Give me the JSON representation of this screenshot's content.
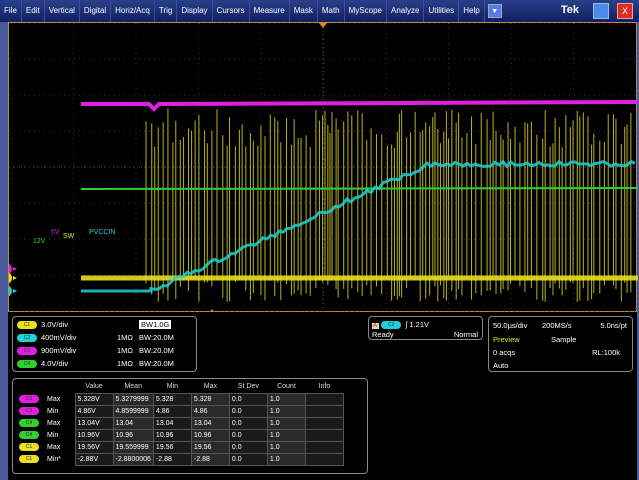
{
  "menu": [
    "File",
    "Edit",
    "Vertical",
    "Digital",
    "Horiz/Acq",
    "Trig",
    "Display",
    "Cursors",
    "Measure",
    "Mask",
    "Math",
    "MyScope",
    "Analyze",
    "Utilities",
    "Help"
  ],
  "brand": "Tek",
  "window": {
    "minimize": "_",
    "close": "X"
  },
  "trace_labels": {
    "c3": "5V",
    "c1": "SW",
    "c4": "12V",
    "c2": "PVCCIN"
  },
  "markers": [
    "3",
    "1",
    "2"
  ],
  "colors": {
    "c1": "#e8e020",
    "c2": "#20d0d8",
    "c3": "#e020e0",
    "c4": "#30d030"
  },
  "channels": [
    {
      "chip": "C1",
      "scale": "3.0V/div",
      "imp": "",
      "bw": "BW1.0G",
      "color": "#e8e020"
    },
    {
      "chip": "C2",
      "scale": "400mV/div",
      "imp": "1MΩ",
      "bw": "BW:20.0M",
      "color": "#20d0d8"
    },
    {
      "chip": "C3",
      "scale": "900mV/div",
      "imp": "1MΩ",
      "bw": "BW:20.0M",
      "color": "#e020e0"
    },
    {
      "chip": "C4",
      "scale": "4.0V/div",
      "imp": "1MΩ",
      "bw": "BW:20.0M",
      "color": "#30d030"
    }
  ],
  "trigger": {
    "a": "A'",
    "chip": "C2",
    "level": "1.21V",
    "state": "Ready",
    "mode": "Normal"
  },
  "acq": {
    "hscale": "50.0µs/div",
    "rate": "200MS/s",
    "res": "5.0ns/pt",
    "preview": "Preview",
    "sample": "Sample",
    "acqs": "0 acqs",
    "rl": "RL:100k",
    "auto": "Auto"
  },
  "meas": {
    "headers": [
      "Value",
      "Mean",
      "Min",
      "Max",
      "St Dev",
      "Count",
      "Info"
    ],
    "rows": [
      {
        "chip": "C3",
        "name": "Max",
        "cells": [
          "5.328V",
          "5.3279999",
          "5.328",
          "5.328",
          "0.0",
          "1.0",
          ""
        ],
        "color": "#e020e0"
      },
      {
        "chip": "C3",
        "name": "Min",
        "cells": [
          "4.86V",
          "4.8599999",
          "4.86",
          "4.86",
          "0.0",
          "1.0",
          ""
        ],
        "color": "#e020e0"
      },
      {
        "chip": "C4",
        "name": "Max",
        "cells": [
          "13.04V",
          "13.04",
          "13.04",
          "13.04",
          "0.0",
          "1.0",
          ""
        ],
        "color": "#30d030"
      },
      {
        "chip": "C4",
        "name": "Min",
        "cells": [
          "10.96V",
          "10.96",
          "10.96",
          "10.96",
          "0.0",
          "1.0",
          ""
        ],
        "color": "#30d030"
      },
      {
        "chip": "C1",
        "name": "Max",
        "cells": [
          "19.56V",
          "19.559999",
          "19.56",
          "19.56",
          "0.0",
          "1.0",
          ""
        ],
        "color": "#e8e020"
      },
      {
        "chip": "C1",
        "name": "Min*",
        "cells": [
          "-2.88V",
          "-2.8800006",
          "-2.88",
          "-2.88",
          "0.0",
          "1.0",
          ""
        ],
        "color": "#e8e020"
      }
    ]
  }
}
